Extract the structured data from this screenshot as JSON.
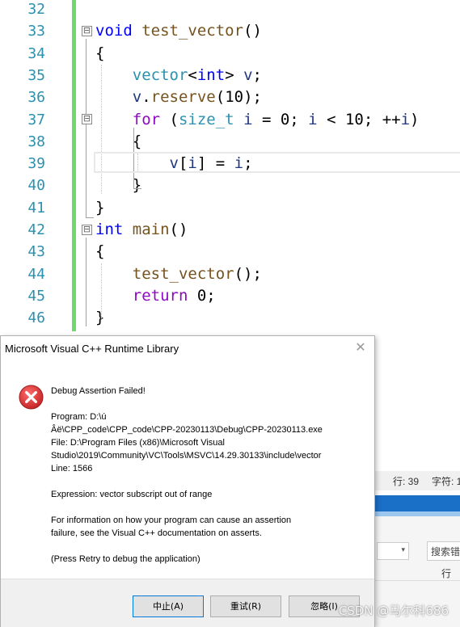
{
  "editor": {
    "line_numbers": [
      "32",
      "33",
      "34",
      "35",
      "36",
      "37",
      "38",
      "39",
      "40",
      "41",
      "42",
      "43",
      "44",
      "45",
      "46"
    ],
    "lines": [
      [],
      [
        [
          "kw",
          "void"
        ],
        [
          "pl",
          " "
        ],
        [
          "fn",
          "test_vector"
        ],
        [
          "pl",
          "()"
        ]
      ],
      [
        [
          "pl",
          "{"
        ]
      ],
      [
        [
          "pl",
          "    "
        ],
        [
          "ty",
          "vector"
        ],
        [
          "pl",
          "<"
        ],
        [
          "kw",
          "int"
        ],
        [
          "pl",
          "> "
        ],
        [
          "vr",
          "v"
        ],
        [
          "pl",
          ";"
        ]
      ],
      [
        [
          "pl",
          "    "
        ],
        [
          "vr",
          "v"
        ],
        [
          "pl",
          "."
        ],
        [
          "fn",
          "reserve"
        ],
        [
          "pl",
          "(10);"
        ]
      ],
      [
        [
          "pl",
          "    "
        ],
        [
          "ctl",
          "for"
        ],
        [
          "pl",
          " ("
        ],
        [
          "ty",
          "size_t"
        ],
        [
          "pl",
          " "
        ],
        [
          "vr",
          "i"
        ],
        [
          "pl",
          " = 0; "
        ],
        [
          "vr",
          "i"
        ],
        [
          "pl",
          " < 10; ++"
        ],
        [
          "vr",
          "i"
        ],
        [
          "pl",
          ")"
        ]
      ],
      [
        [
          "pl",
          "    {"
        ]
      ],
      [
        [
          "pl",
          "        "
        ],
        [
          "vr",
          "v"
        ],
        [
          "pl",
          "["
        ],
        [
          "vr",
          "i"
        ],
        [
          "pl",
          "] = "
        ],
        [
          "vr",
          "i"
        ],
        [
          "pl",
          ";"
        ]
      ],
      [
        [
          "pl",
          "    }"
        ]
      ],
      [
        [
          "pl",
          "}"
        ]
      ],
      [
        [
          "kw",
          "int"
        ],
        [
          "pl",
          " "
        ],
        [
          "fn",
          "main"
        ],
        [
          "pl",
          "()"
        ]
      ],
      [
        [
          "pl",
          "{"
        ]
      ],
      [
        [
          "pl",
          "    "
        ],
        [
          "fn",
          "test_vector"
        ],
        [
          "pl",
          "();"
        ]
      ],
      [
        [
          "pl",
          "    "
        ],
        [
          "ctl",
          "return"
        ],
        [
          "pl",
          " 0;"
        ]
      ],
      [
        [
          "pl",
          "}"
        ]
      ]
    ],
    "fold_markers": [
      "⊟",
      "⊟",
      "⊟"
    ]
  },
  "background_ide": {
    "status_line": "行: 39",
    "status_char": "字符: 1",
    "search_placeholder": "搜索错",
    "column_header": "行"
  },
  "dialog": {
    "title": "Microsoft Visual C++ Runtime Library",
    "close_glyph": "✕",
    "icon": "error-icon",
    "heading": "Debug Assertion Failed!",
    "program_line1": "Program: D:\\ú",
    "program_line2": "Âë\\CPP_code\\CPP_code\\CPP-20230113\\Debug\\CPP-20230113.exe",
    "file_line1": "File: D:\\Program Files (x86)\\Microsoft Visual",
    "file_line2": "Studio\\2019\\Community\\VC\\Tools\\MSVC\\14.29.30133\\include\\vector",
    "line": "Line: 1566",
    "expression": "Expression: vector subscript out of range",
    "info_line1": "For information on how your program can cause an assertion",
    "info_line2": "failure, see the Visual C++ documentation on asserts.",
    "retry_hint": "(Press Retry to debug the application)",
    "buttons": {
      "abort": "中止(A)",
      "retry": "重试(R)",
      "ignore": "忽略(I)"
    }
  },
  "watermark": "CSDN @马尔科686",
  "colors": {
    "keyword": "#0000ff",
    "type": "#2b91af",
    "function": "#74531f",
    "variable": "#1f377f",
    "control": "#8f08c4",
    "change_bar": "#6cdb6c",
    "error_red": "#d32f2f"
  }
}
